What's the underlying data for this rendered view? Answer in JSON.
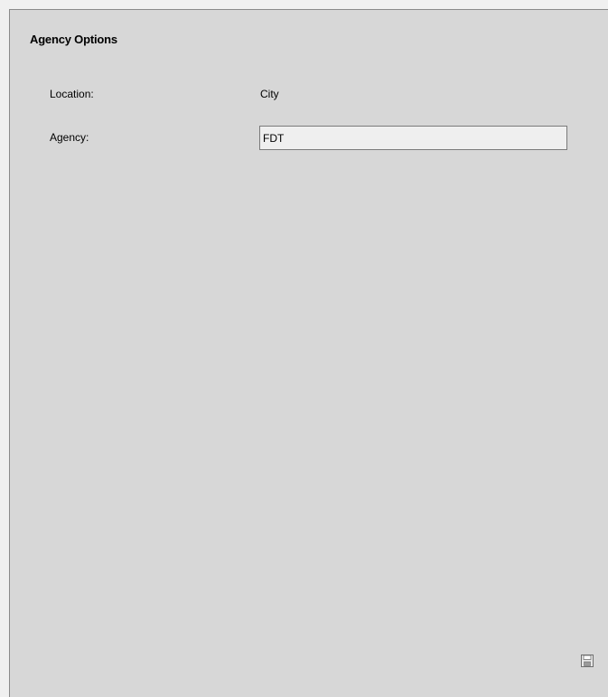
{
  "panel": {
    "title": "Agency Options"
  },
  "fields": {
    "location_label": "Location:",
    "location_value": "City",
    "agency_label": "Agency:",
    "agency_value": "FDT"
  },
  "toolbar": {
    "save_icon": "save-icon"
  }
}
